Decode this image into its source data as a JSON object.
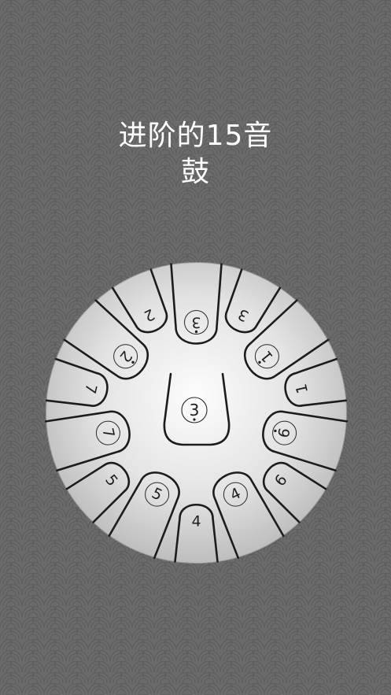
{
  "title": {
    "line1": "进阶的15音",
    "line2": "鼓"
  },
  "drum": {
    "center_note": "3",
    "notes": [
      "3",
      "3",
      "1",
      "1",
      "6",
      "6",
      "4",
      "4",
      "5",
      "5",
      "7",
      "7",
      "2",
      "2"
    ]
  },
  "colors": {
    "background": "#6b6b6b",
    "pattern": "#5e5e5e",
    "drum_light": "#fbfbfb",
    "drum_dark": "#b7b7b7",
    "line": "#1c1c1c"
  }
}
